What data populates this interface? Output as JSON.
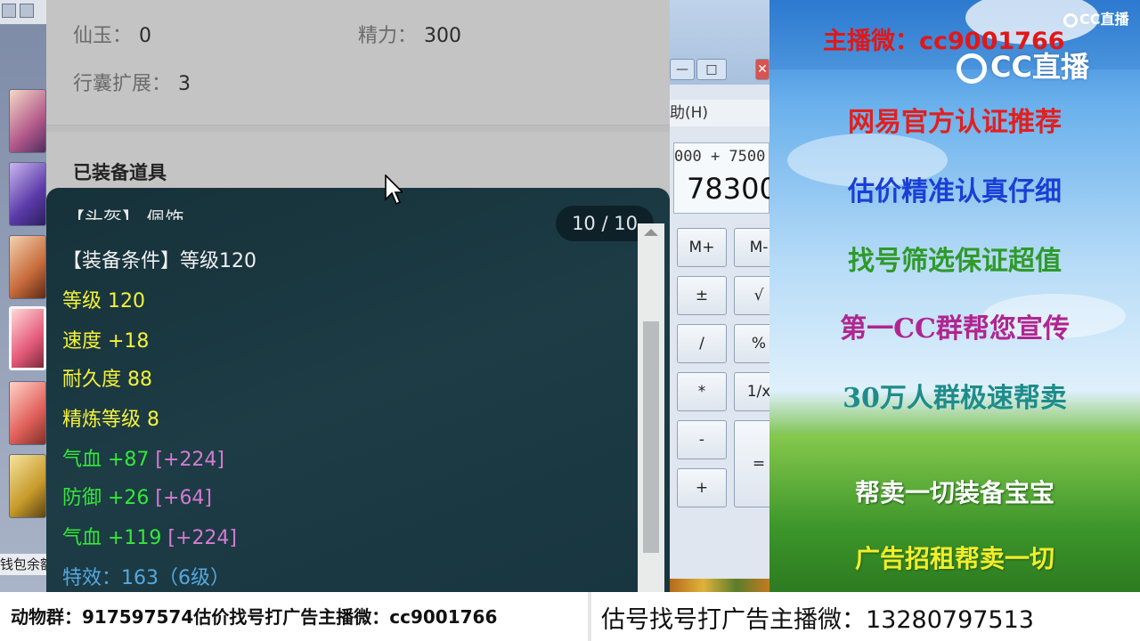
{
  "game_sidebar": {
    "bottom_text": "钱包余额"
  },
  "info_panel": {
    "xianyu_label": "仙玉：",
    "xianyu_value": "0",
    "jingli_label": "精力：",
    "jingli_value": "300",
    "bag_label": "行囊扩展：",
    "bag_value": "3",
    "equipped_title": "已装备道具"
  },
  "tooltip": {
    "cut_title": "【头盔】 佩饰",
    "pager": "10 / 10",
    "lines": [
      {
        "text": "【装备条件】等级120",
        "bonus": ""
      },
      {
        "text": "等级 120",
        "bonus": ""
      },
      {
        "text": "速度 +18",
        "bonus": ""
      },
      {
        "text": "耐久度 88",
        "bonus": ""
      },
      {
        "text": "精炼等级 8",
        "bonus": ""
      },
      {
        "text": "气血 +87",
        "bonus": "[+224]"
      },
      {
        "text": "防御 +26",
        "bonus": "[+64]"
      },
      {
        "text": "气血 +119",
        "bonus": "[+224]"
      },
      {
        "text": "特效：163（6级）",
        "bonus": ""
      }
    ],
    "colors": {
      "condition": "#f0f0f0",
      "base": "#f4f23a",
      "refine": "#34e83a",
      "bonus": "#d57ad3",
      "special": "#55a8e0"
    }
  },
  "calculator": {
    "menu": "助(H)",
    "expression": "000 + 7500",
    "result": "78300",
    "buttons": [
      "M+",
      "M-",
      "±",
      "√",
      "/",
      "%",
      "*",
      "1/x",
      "-",
      "+",
      "="
    ],
    "window_buttons": [
      "—",
      "□",
      "✕"
    ]
  },
  "ad": {
    "anchor": "主播微：cc9001766",
    "logo_small": "CC直播",
    "logo_big": "CC直播",
    "lines": [
      {
        "text": "网易官方认证推荐",
        "color": "#e02020"
      },
      {
        "text": "估价精准认真仔细",
        "color": "#1a3fd6"
      },
      {
        "text": "找号筛选保证超值",
        "color": "#2f9a2a"
      },
      {
        "text": "第一CC群帮您宣传",
        "color": "#b0258f"
      },
      {
        "text": "30万人群极速帮卖",
        "color": "#1e8c8a"
      },
      {
        "text": "帮卖一切装备宝宝",
        "color": "#ffffff"
      },
      {
        "text": "广告招租帮卖一切",
        "color": "#f2ee2a"
      }
    ]
  },
  "banner": {
    "left": "动物群：917597574估价找号打广告主播微：cc9001766",
    "right": "估号找号打广告主播微：13280797513"
  }
}
